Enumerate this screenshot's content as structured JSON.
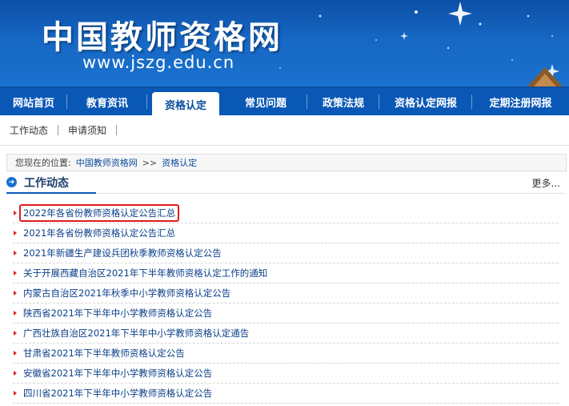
{
  "banner": {
    "site_title": "中国教师资格网",
    "site_url": "www.jszg.edu.cn"
  },
  "main_nav": [
    {
      "label": "网站首页"
    },
    {
      "label": "教育资讯"
    },
    {
      "label": "资格认定",
      "active": true
    },
    {
      "label": "常见问题"
    },
    {
      "label": "政策法规"
    },
    {
      "label": "资格认定网报"
    },
    {
      "label": "定期注册网报"
    }
  ],
  "sub_nav": [
    {
      "label": "工作动态"
    },
    {
      "label": "申请须知"
    }
  ],
  "breadcrumb": {
    "prefix": "您现在的位置:",
    "home": "中国教师资格网",
    "separator": ">>",
    "current": "资格认定"
  },
  "section": {
    "title": "工作动态",
    "more": "更多..."
  },
  "news": [
    {
      "title": "2022年各省份教师资格认定公告汇总",
      "highlighted": true
    },
    {
      "title": "2021年各省份教师资格认定公告汇总"
    },
    {
      "title": "2021年新疆生产建设兵团秋季教师资格认定公告"
    },
    {
      "title": "关于开展西藏自治区2021年下半年教师资格认定工作的通知"
    },
    {
      "title": "内蒙古自治区2021年秋季中小学教师资格认定公告"
    },
    {
      "title": "陕西省2021年下半年中小学教师资格认定公告"
    },
    {
      "title": "广西壮族自治区2021年下半年中小学教师资格认定通告"
    },
    {
      "title": "甘肃省2021年下半年教师资格认定公告"
    },
    {
      "title": "安徽省2021年下半年中小学教师资格认定公告"
    },
    {
      "title": "四川省2021年下半年中小学教师资格认定公告"
    }
  ],
  "colors": {
    "banner_blue": "#1667c4",
    "nav_blue": "#0a58b6",
    "link_blue": "#0b3f88",
    "bullet_red": "#d22525",
    "highlight_red": "#e11c1c"
  }
}
